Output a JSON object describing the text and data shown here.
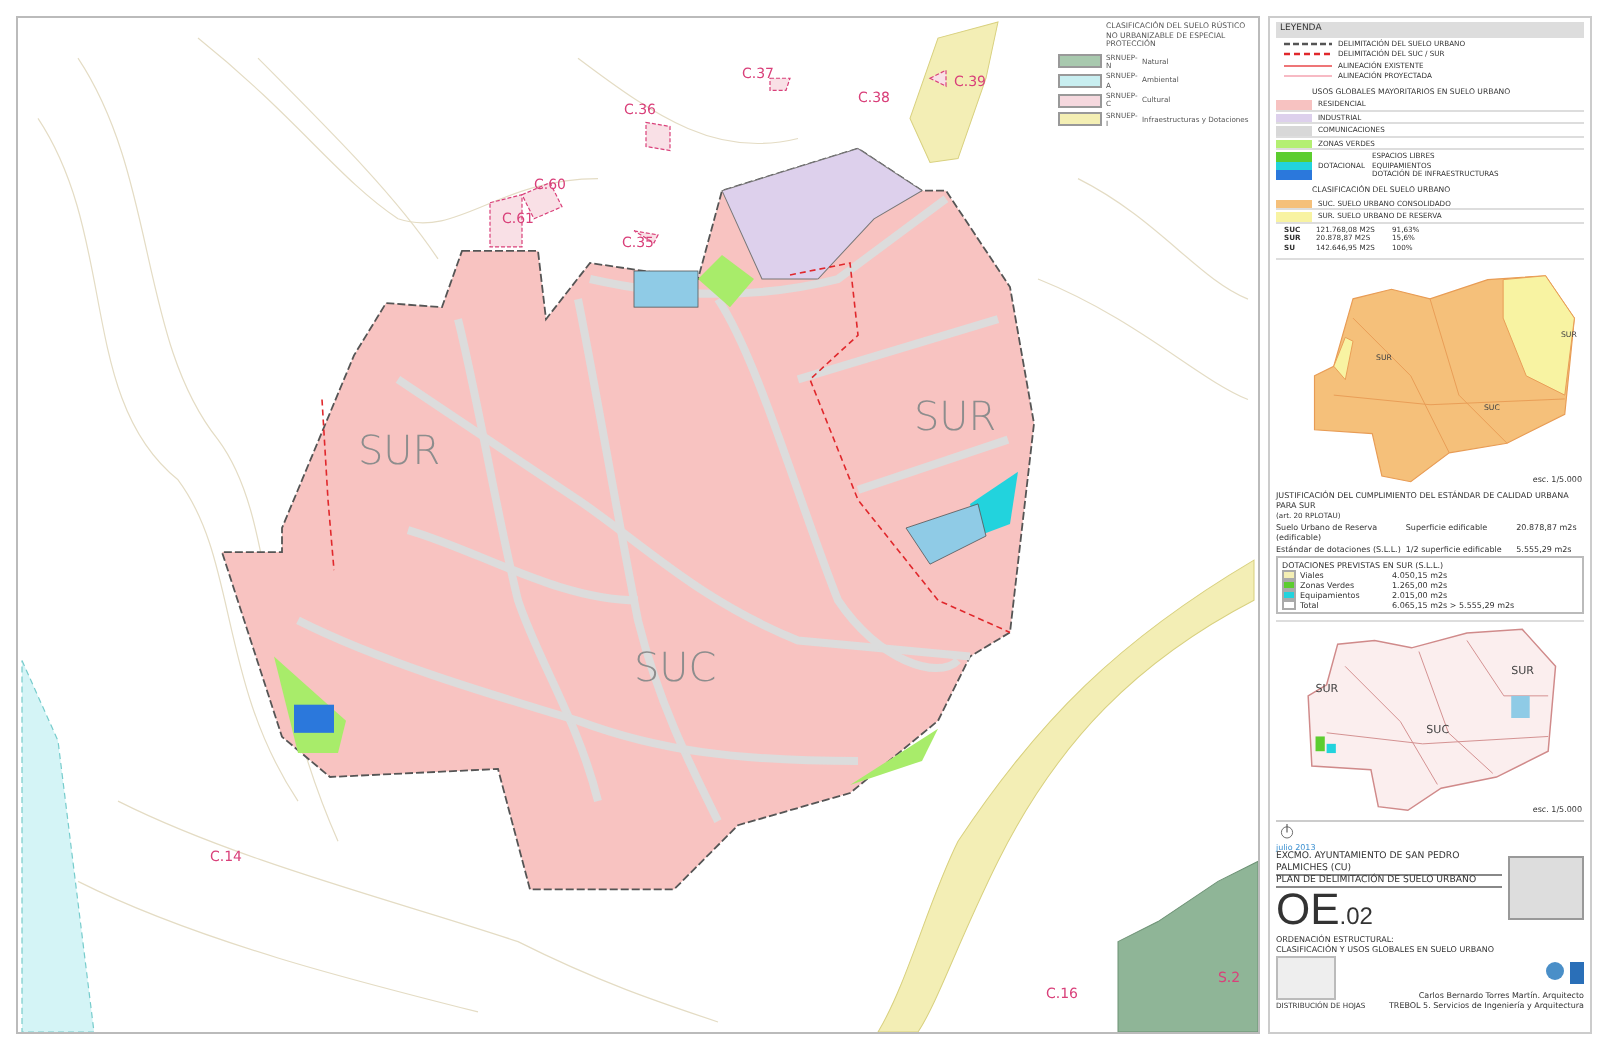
{
  "map": {
    "zone_labels": [
      {
        "text": "SUR"
      },
      {
        "text": "SUC"
      },
      {
        "text": "SUR"
      }
    ],
    "site_labels": [
      {
        "text": "C.37"
      },
      {
        "text": "C.38"
      },
      {
        "text": "C.39"
      },
      {
        "text": "C.36"
      },
      {
        "text": "C.60"
      },
      {
        "text": "C.61"
      },
      {
        "text": "C.35"
      },
      {
        "text": "C.14"
      },
      {
        "text": "C.16"
      },
      {
        "text": "S.2"
      }
    ],
    "legend": {
      "title": "CLASIFICACIÓN DEL SUELO RÚSTICO NO URBANIZABLE DE ESPECIAL PROTECCIÓN",
      "items": [
        {
          "code": "SRNUEP-N",
          "label": "Natural",
          "color": "#a8c9ae"
        },
        {
          "code": "SRNUEP-A",
          "label": "Ambiental",
          "color": "#c8eef0"
        },
        {
          "code": "SRNUEP-C",
          "label": "Cultural",
          "color": "#f5d8de"
        },
        {
          "code": "SRNUEP-I",
          "label": "Infraestructuras y Dotaciones",
          "color": "#f4efb4"
        }
      ]
    }
  },
  "legend": {
    "title": "LEYENDA",
    "lines": [
      {
        "label": "DELIMITACIÓN DEL SUELO URBANO",
        "kind": "boundary"
      },
      {
        "label": "DELIMITACIÓN DEL SUC / SUR",
        "kind": "red-dashed"
      },
      {
        "label": "ALINEACIÓN EXISTENTE",
        "kind": "red-solid"
      },
      {
        "label": "ALINEACIÓN PROYECTADA",
        "kind": "pink-solid"
      }
    ],
    "uses": {
      "title": "USOS GLOBALES MAYORITARIOS EN SUELO URBANO",
      "group_label": "DOTACIONAL",
      "items": [
        {
          "label": "RESIDENCIAL",
          "color": "#f7c2c1",
          "kind": "plain"
        },
        {
          "label": "INDUSTRIAL",
          "color": "#ddd0ec",
          "kind": "plain"
        },
        {
          "label": "COMUNICACIONES",
          "color": "#d8d8d8",
          "kind": "plain"
        },
        {
          "label": "ZONAS VERDES",
          "color": "#b4ef72",
          "kind": "plain"
        },
        {
          "label": "ESPACIOS LIBRES",
          "color": "#5ccd2f",
          "kind": "group"
        },
        {
          "label": "EQUIPAMIENTOS",
          "color": "#22d3dd",
          "kind": "group"
        },
        {
          "label": "DOTACIÓN DE INFRAESTRUCTURAS",
          "color": "#2b78dc",
          "kind": "group"
        }
      ]
    },
    "classes": {
      "title": "CLASIFICACIÓN DEL SUELO URBANO",
      "items": [
        {
          "label": "SUC. SUELO URBANO CONSOLIDADO",
          "color": "#f5c07a"
        },
        {
          "label": "SUR. SUELO URBANO DE RESERVA",
          "color": "#f8f3a2"
        }
      ],
      "stats": [
        {
          "code": "SUC",
          "value": "121.768,08 M2S",
          "share": "91,63%"
        },
        {
          "code": "SUR",
          "value": "20.878,87 M2S",
          "share": "15,6%"
        },
        {
          "code": "SU",
          "value": "142.646,95 M2S",
          "share": "100%"
        }
      ]
    }
  },
  "inset_top": {
    "labels": [
      {
        "text": "SUR"
      },
      {
        "text": "SUC"
      },
      {
        "text": "SUR"
      }
    ],
    "scale": "esc. 1/5.000"
  },
  "justification": {
    "title": "JUSTIFICACIÓN DEL CUMPLIMIENTO DEL ESTÁNDAR DE CALIDAD URBANA PARA SUR",
    "subtitle": "(art. 20 RPLOTAU)",
    "rows": [
      {
        "label": "Suelo Urbano de Reserva (edificable)",
        "measure": "Superficie edificable",
        "value": "20.878,87 m2s"
      },
      {
        "label": "Estándar de dotaciones (S.L.L.)",
        "measure": "1/2 superficie edificable",
        "value": "5.555,29 m2s"
      }
    ],
    "box_title": "DOTACIONES PREVISTAS EN SUR (S.L.L.)",
    "items": [
      {
        "label": "Viales",
        "value": "4.050,15 m2s",
        "color": "#f4efb4"
      },
      {
        "label": "Zonas Verdes",
        "value": "1.265,00 m2s",
        "color": "#5ccd2f"
      },
      {
        "label": "Equipamientos",
        "value": "2.015,00 m2s",
        "color": "#22d3dd"
      },
      {
        "label": "Total",
        "value": "6.065,15 m2s > 5.555,29 m2s",
        "color": "#ffffff"
      }
    ]
  },
  "inset_bottom": {
    "labels": [
      {
        "text": "SUR"
      },
      {
        "text": "SUC"
      },
      {
        "text": "SUR"
      }
    ],
    "scale": "esc. 1/5.000"
  },
  "title_block": {
    "date": "julio 2013",
    "client": "EXCMO. AYUNTAMIENTO DE SAN PEDRO PALMICHES (CU)",
    "plan": "PLAN DE DELIMITACIÓN DE SUELO URBANO",
    "sheet_prefix": "OE",
    "sheet_number": ".02",
    "sheet_title": "ORDENACIÓN ESTRUCTURAL:",
    "sheet_subtitle": "CLASIFICACIÓN Y USOS GLOBALES EN SUELO URBANO",
    "distribution": "DISTRIBUCIÓN DE HOJAS",
    "author": "Carlos Bernardo Torres Martín. Arquitecto",
    "firm": "TREBOL 5. Servicios de Ingeniería y Arquitectura"
  }
}
